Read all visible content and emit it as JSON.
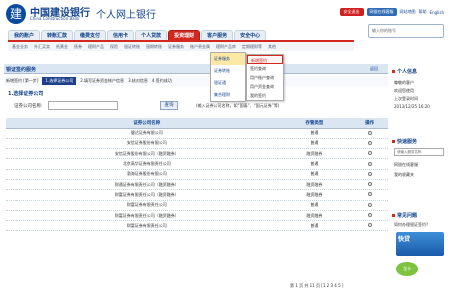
{
  "header": {
    "logo_glyph": "建",
    "bank_name": "中国建设银行",
    "bank_en": "China Construction Bank",
    "site_title": "个人网上银行",
    "links": [
      {
        "label": "安全退出",
        "style": "red"
      },
      {
        "label": "网银在线客服",
        "style": "blue"
      },
      {
        "label": "网站地图",
        "style": ""
      },
      {
        "label": "帮助",
        "style": ""
      },
      {
        "label": "English",
        "style": ""
      }
    ]
  },
  "login_box": "输入你的账号",
  "nav": {
    "tabs": [
      {
        "label": "我的账户"
      },
      {
        "label": "转账汇款"
      },
      {
        "label": "缴费支付"
      },
      {
        "label": "信用卡"
      },
      {
        "label": "个人贷款"
      },
      {
        "label": "投资理财",
        "active": true
      },
      {
        "label": "客户服务"
      },
      {
        "label": "安全中心"
      }
    ]
  },
  "subnav": [
    "基金业务",
    "外汇买卖",
    "纸黄金",
    "债券",
    "理财产品",
    "保险",
    "银证转账",
    "银期转账",
    "证券服务",
    "账户贵金属",
    "理财产品库",
    "定期理财等",
    "其他"
  ],
  "dropdown": {
    "items": [
      {
        "label": "证券服务",
        "active": true
      },
      {
        "label": "证券转账"
      },
      {
        "label": "银证通"
      },
      {
        "label": "集合理财"
      }
    ]
  },
  "submenu": {
    "items": [
      {
        "label": "新增签约",
        "highlight": true
      },
      {
        "label": "签约查询"
      },
      {
        "label": "用户账户查询"
      },
      {
        "label": "用户资金查询"
      },
      {
        "label": "我的签约"
      }
    ]
  },
  "panel": {
    "title": "银证签约服务",
    "back": "返回"
  },
  "steps": [
    "新增签约 [第一步]",
    "1.选择证券公司",
    "2.填写证券资金帐户信息",
    "3.核对信息",
    "4.签约成功"
  ],
  "section": {
    "title": "1.选择证券公司",
    "filter_label": "证券公司名称:",
    "query_button": "查询",
    "hint": "(输入证券公司名称，如“国泰”、“国元证券”等)"
  },
  "table": {
    "headers": [
      "",
      "证券公司名称",
      "存管类型",
      "操作"
    ],
    "rows": [
      [
        "健达证券有限公司",
        "普通"
      ],
      [
        "安信证券股份有限公司",
        "普通"
      ],
      [
        "安信证券股份有限公司（融资融券）",
        "融资融券"
      ],
      [
        "北京高华证券有限责任公司",
        "普通"
      ],
      [
        "渤海证券股份有限公司",
        "普通"
      ],
      [
        "财通证券有限责任公司（融资融券）",
        "融资融券"
      ],
      [
        "财富证券有限责任公司（融资融券）",
        "融资融券"
      ],
      [
        "财富证券有限责任公司",
        "普通"
      ],
      [
        "财富证券有限责任公司（融资融券）",
        "融资融券"
      ],
      [
        "财富证券有限责任公司",
        "普通"
      ]
    ]
  },
  "pager": "第 1 页 共 11 页  [1 2 3 4 5 ]",
  "right": {
    "personal_title": "个人信息",
    "personal_lines": [
      "尊敬的客户",
      "欢迎您使用",
      "上次登录时间",
      "2013/12/25 16:20"
    ],
    "fast_title": "快速服务",
    "fast_input": "请输入服务名称",
    "fast_lines": [
      "网银在线客服",
      "我的收藏夹"
    ],
    "faq_title": "常见问题",
    "faq_lines": [
      "如何办理银证签约?",
      "如何开通银证转账?",
      "证券转账时间"
    ],
    "promo1": "快贷",
    "promo2": "龙卡"
  }
}
